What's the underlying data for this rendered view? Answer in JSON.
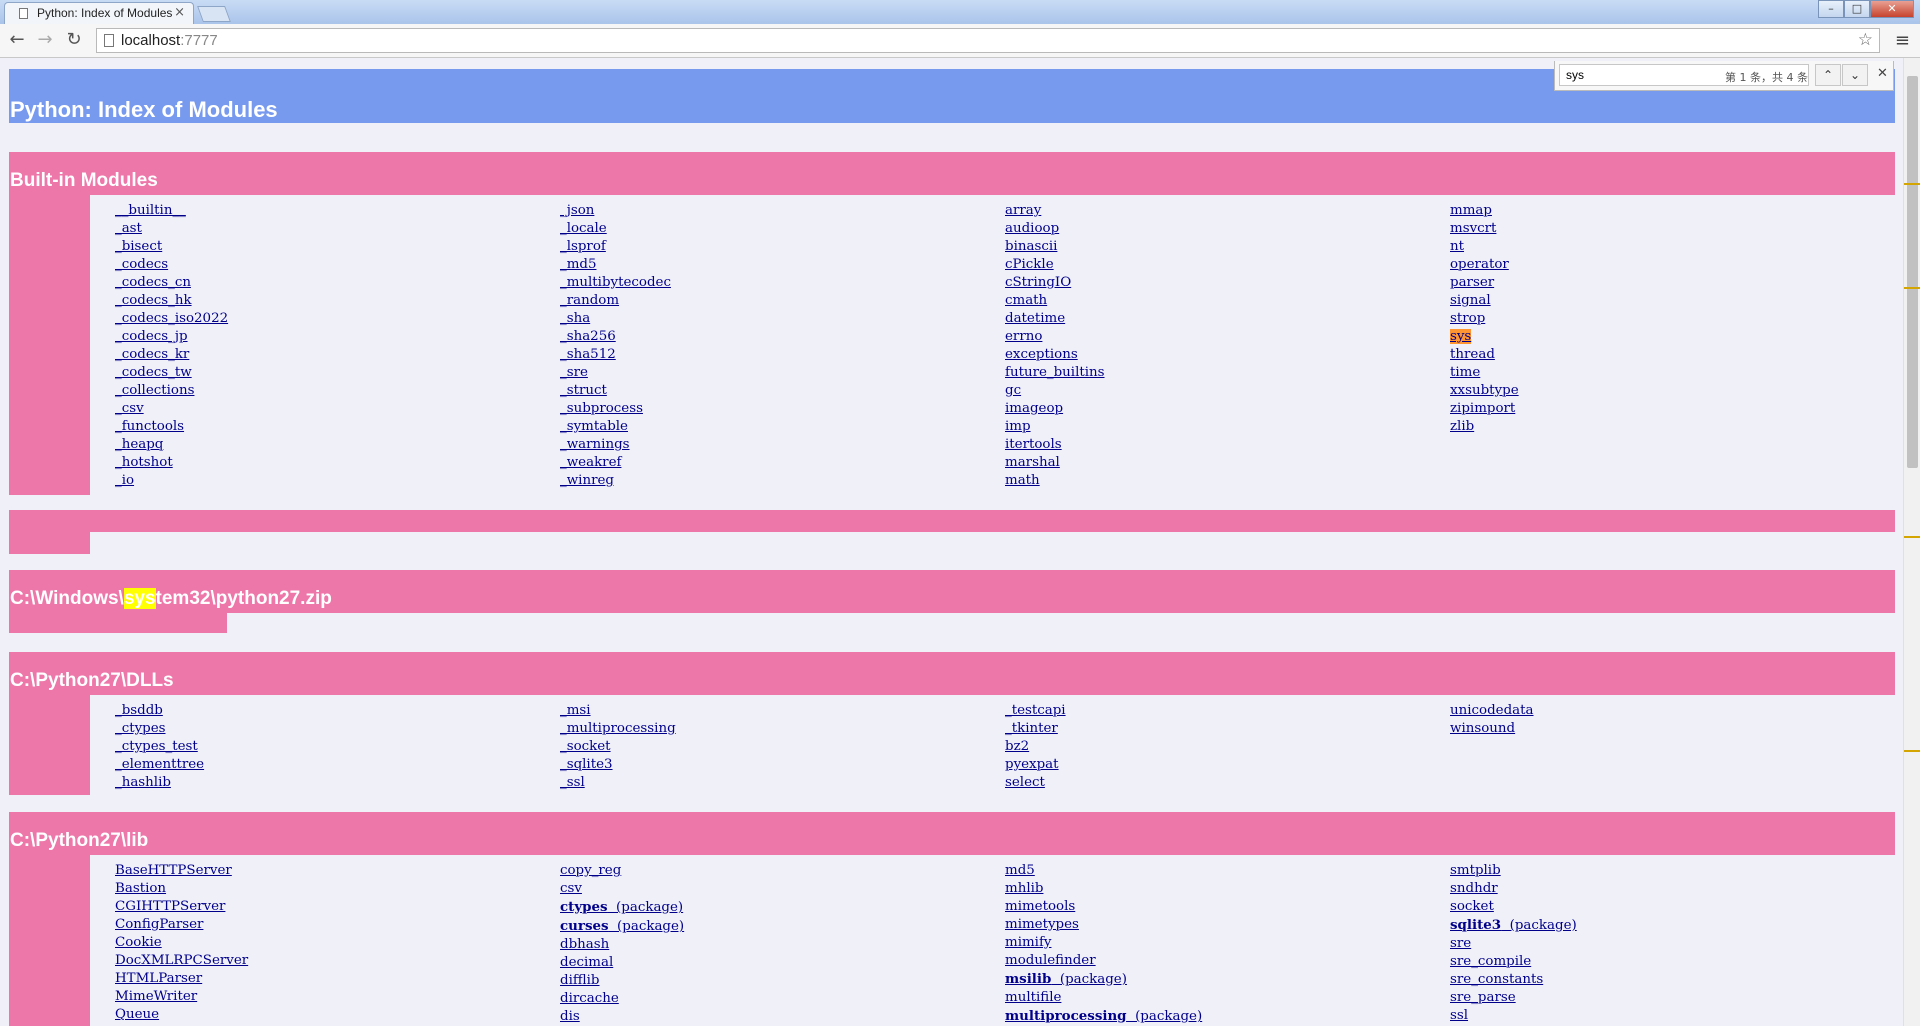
{
  "browser": {
    "tab_title": "Python: Index of Modules",
    "url_host": "localhost",
    "url_port": ":7777",
    "window_controls": [
      "–",
      "□",
      "✕"
    ],
    "find": {
      "query": "sys",
      "match_count": "第 1 条，共 4 条"
    },
    "highlight_color": "#ffff00",
    "current_match_color": "#ff9632"
  },
  "page": {
    "title": "Python: Index of Modules",
    "title_color": "#7799ee",
    "section_color": "#ee77aa",
    "sections": [
      {
        "heading": "Built-in Modules",
        "columns": [
          [
            "__builtin__",
            "_ast",
            "_bisect",
            "_codecs",
            "_codecs_cn",
            "_codecs_hk",
            "_codecs_iso2022",
            "_codecs_jp",
            "_codecs_kr",
            "_codecs_tw",
            "_collections",
            "_csv",
            "_functools",
            "_heapq",
            "_hotshot",
            "_io"
          ],
          [
            "_json",
            "_locale",
            "_lsprof",
            "_md5",
            "_multibytecodec",
            "_random",
            "_sha",
            "_sha256",
            "_sha512",
            "_sre",
            "_struct",
            "_subprocess",
            "_symtable",
            "_warnings",
            "_weakref",
            "_winreg"
          ],
          [
            "array",
            "audioop",
            "binascii",
            "cPickle",
            "cStringIO",
            "cmath",
            "datetime",
            "errno",
            "exceptions",
            "future_builtins",
            "gc",
            "imageop",
            "imp",
            "itertools",
            "marshal",
            "math"
          ],
          [
            "mmap",
            "msvcrt",
            "nt",
            "operator",
            "parser",
            "signal",
            "strop",
            "sys",
            "thread",
            "time",
            "xxsubtype",
            "zipimport",
            "zlib"
          ]
        ]
      },
      {
        "heading": "",
        "columns": []
      },
      {
        "heading_parts": [
          "C:\\Windows\\",
          "sys",
          "tem32\\python27.zip"
        ],
        "columns": []
      },
      {
        "heading": "C:\\Python27\\DLLs",
        "columns": [
          [
            "_bsddb",
            "_ctypes",
            "_ctypes_test",
            "_elementtree",
            "_hashlib"
          ],
          [
            "_msi",
            "_multiprocessing",
            "_socket",
            "_sqlite3",
            "_ssl"
          ],
          [
            "_testcapi",
            "_tkinter",
            "bz2",
            "pyexpat",
            "select"
          ],
          [
            "unicodedata",
            "winsound"
          ]
        ]
      },
      {
        "heading": "C:\\Python27\\lib",
        "package_label": "(package)",
        "columns": [
          [
            "BaseHTTPServer",
            "Bastion",
            "CGIHTTPServer",
            "ConfigParser",
            "Cookie",
            "DocXMLRPCServer",
            "HTMLParser",
            "MimeWriter",
            "Queue"
          ],
          [
            "copy_reg",
            "csv",
            "ctypes",
            "curses",
            "dbhash",
            "decimal",
            "difflib",
            "dircache",
            "dis"
          ],
          [
            "md5",
            "mhlib",
            "mimetools",
            "mimetypes",
            "mimify",
            "modulefinder",
            "msilib",
            "multifile",
            "multiprocessing"
          ],
          [
            "smtplib",
            "sndhdr",
            "socket",
            "sqlite3",
            "sre",
            "sre_compile",
            "sre_constants",
            "sre_parse",
            "ssl"
          ]
        ],
        "packages": [
          "ctypes",
          "curses",
          "msilib",
          "multiprocessing",
          "sqlite3"
        ]
      }
    ]
  }
}
